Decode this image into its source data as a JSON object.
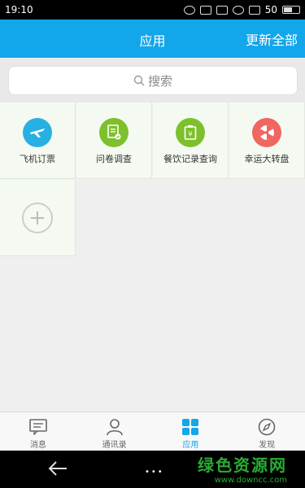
{
  "status_bar": {
    "time": "19:10",
    "battery": "50"
  },
  "header": {
    "title": "应用",
    "update_all": "更新全部"
  },
  "search": {
    "placeholder": "搜索"
  },
  "apps": [
    {
      "label": "飞机订票",
      "icon": "airplane-ticket-icon",
      "color": "#27b1e3"
    },
    {
      "label": "问卷调查",
      "icon": "questionnaire-icon",
      "color": "#7dc02b"
    },
    {
      "label": "餐饮记录查询",
      "icon": "dining-record-icon",
      "color": "#7dc02b"
    },
    {
      "label": "幸运大转盘",
      "icon": "lucky-wheel-icon",
      "color": "#f06660"
    }
  ],
  "add_app": {
    "icon": "plus-icon"
  },
  "tabbar": {
    "tabs": [
      {
        "label": "消息",
        "icon": "message-icon",
        "active": false
      },
      {
        "label": "通讯录",
        "icon": "contacts-icon",
        "active": false
      },
      {
        "label": "应用",
        "icon": "apps-grid-icon",
        "active": true
      },
      {
        "label": "发现",
        "icon": "compass-icon",
        "active": false
      }
    ]
  },
  "watermark": {
    "title": "绿色资源网",
    "url": "www.downcc.com"
  },
  "colors": {
    "primary": "#12a6ea",
    "tile_bg": "#f4faf1",
    "page_bg": "#efefef"
  }
}
